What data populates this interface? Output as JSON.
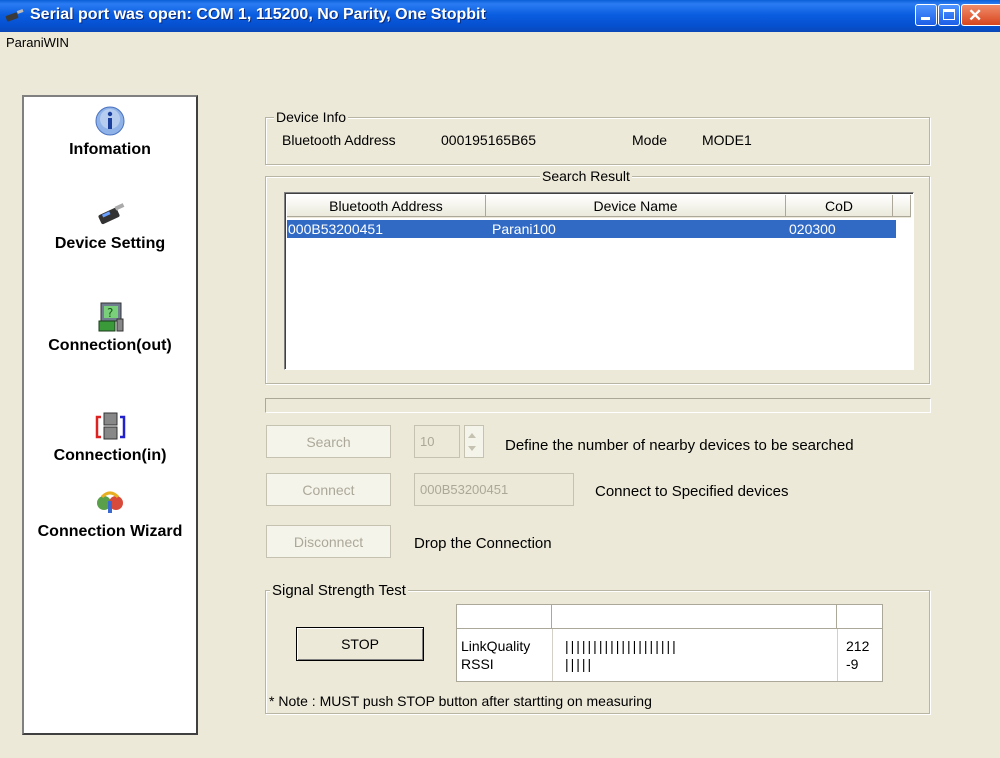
{
  "window": {
    "title": "Serial port was open: COM 1, 115200, No Parity, One Stopbit",
    "menu_app_label": "ParaniWIN"
  },
  "sidebar": {
    "items": [
      {
        "label": "Infomation",
        "icon": "info-icon"
      },
      {
        "label": "Device Setting",
        "icon": "device-icon"
      },
      {
        "label": "Connection(out)",
        "icon": "connection-out-icon"
      },
      {
        "label": "Connection(in)",
        "icon": "connection-in-icon"
      },
      {
        "label": "Connection Wizard",
        "icon": "wizard-icon"
      }
    ]
  },
  "device_info": {
    "legend": "Device Info",
    "bt_address_label": "Bluetooth Address",
    "bt_address_value": "000195165B65",
    "mode_label": "Mode",
    "mode_value": "MODE1"
  },
  "search_result": {
    "legend": "Search Result",
    "columns": [
      "Bluetooth Address",
      "Device Name",
      "CoD"
    ],
    "rows": [
      {
        "address": "000B53200451",
        "name": "Parani100",
        "cod": "020300",
        "selected": true
      }
    ]
  },
  "controls": {
    "search_button": "Search",
    "search_count": "10",
    "search_desc": "Define the number of nearby devices to be searched",
    "connect_button": "Connect",
    "connect_address": "000B53200451",
    "connect_desc": "Connect to Specified devices",
    "disconnect_button": "Disconnect",
    "disconnect_desc": "Drop the Connection"
  },
  "signal_test": {
    "legend": "Signal Strength Test",
    "stop_button": "STOP",
    "rows": [
      {
        "label": "LinkQuality",
        "bars": "||||||||||||||||||||",
        "value": "212"
      },
      {
        "label": "RSSI",
        "bars": "|||||",
        "value": "-9"
      }
    ],
    "note": "* Note : MUST push STOP button after startting on measuring"
  },
  "colors": {
    "titlebar": "#0a5fd6",
    "selection": "#316ac5",
    "window_bg": "#ece9d8"
  }
}
